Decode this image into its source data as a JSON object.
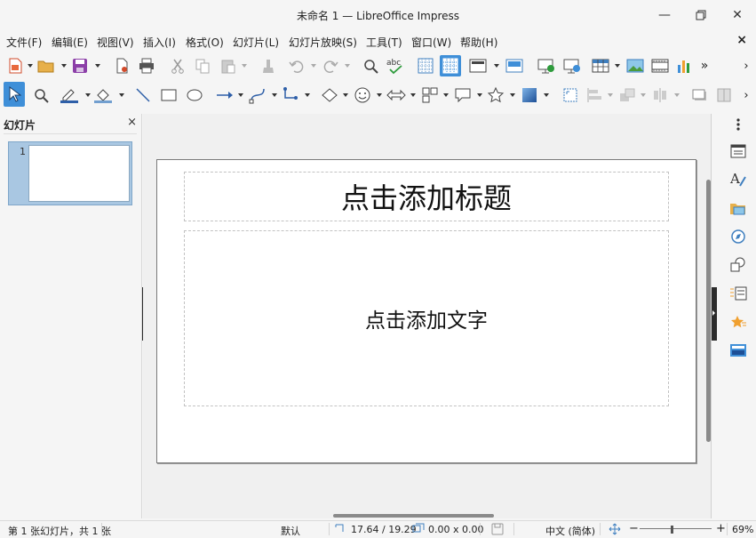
{
  "window": {
    "title": "未命名 1 — LibreOffice Impress"
  },
  "menubar": {
    "items": [
      "文件(F)",
      "编辑(E)",
      "视图(V)",
      "插入(I)",
      "格式(O)",
      "幻灯片(L)",
      "幻灯片放映(S)",
      "工具(T)",
      "窗口(W)",
      "帮助(H)"
    ],
    "close_doc": "×"
  },
  "slide_pane": {
    "title": "幻灯片",
    "close": "×",
    "slides": [
      {
        "number": "1"
      }
    ]
  },
  "slide": {
    "title_placeholder": "点击添加标题",
    "content_placeholder": "点击添加文字"
  },
  "statusbar": {
    "slide_position": "第 1 张幻灯片，共 1 张",
    "layout": "默认",
    "cursor_position": "17.64 / 19.29",
    "object_size": "0.00 x 0.00",
    "language": "中文 (简体)",
    "zoom_minus": "−",
    "zoom_plus": "+",
    "zoom": "69%",
    "zoom_slider_level": 0.45
  },
  "colors": {
    "accent": "#3f8fd8",
    "selected_slide": "#a9c7e2"
  }
}
